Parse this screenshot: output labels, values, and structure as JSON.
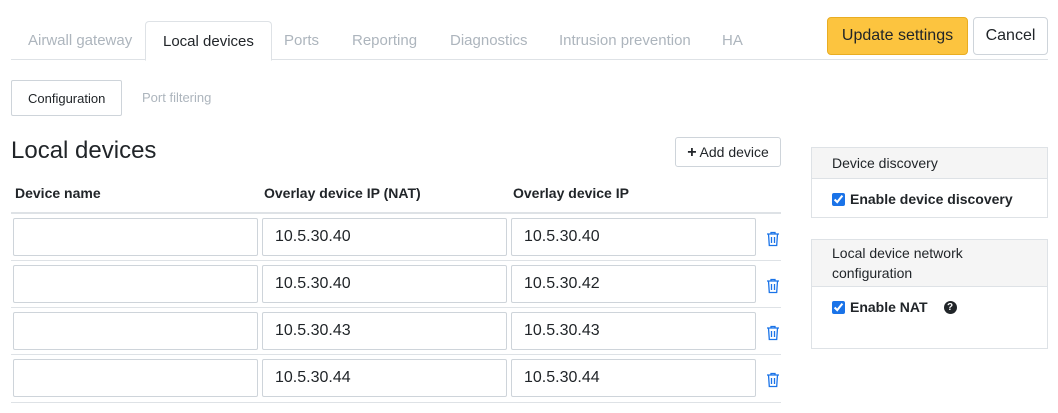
{
  "tabs": [
    {
      "label": "Airwall gateway"
    },
    {
      "label": "Local devices"
    },
    {
      "label": "Ports"
    },
    {
      "label": "Reporting"
    },
    {
      "label": "Diagnostics"
    },
    {
      "label": "Intrusion prevention"
    },
    {
      "label": "HA"
    }
  ],
  "actions": {
    "update_label": "Update settings",
    "cancel_label": "Cancel"
  },
  "subtabs": [
    {
      "label": "Configuration"
    },
    {
      "label": "Port filtering"
    }
  ],
  "section": {
    "title": "Local devices",
    "add_label": "Add device",
    "add_icon": "plus-icon"
  },
  "table": {
    "headers": [
      "Device name",
      "Overlay device IP (NAT)",
      "Overlay device IP"
    ],
    "rows": [
      {
        "name": "",
        "nat_ip": "10.5.30.40",
        "ip": "10.5.30.40"
      },
      {
        "name": "",
        "nat_ip": "10.5.30.40",
        "ip": "10.5.30.42"
      },
      {
        "name": "",
        "nat_ip": "10.5.30.43",
        "ip": "10.5.30.43"
      },
      {
        "name": "",
        "nat_ip": "10.5.30.44",
        "ip": "10.5.30.44"
      }
    ]
  },
  "panels": {
    "discovery": {
      "header": "Device discovery",
      "checkbox_label": "Enable device discovery",
      "checked": true
    },
    "network": {
      "header": "Local device network configuration",
      "checkbox_label": "Enable NAT",
      "checked": true,
      "help_glyph": "?"
    }
  },
  "colors": {
    "accent": "#fcc43f",
    "trash": "#1a73e8",
    "muted": "#adb5bd"
  }
}
